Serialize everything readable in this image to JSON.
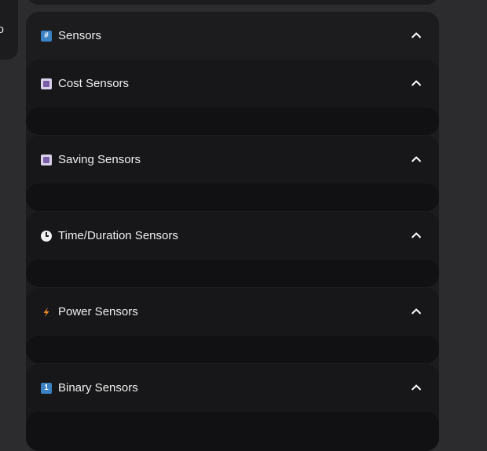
{
  "left_panel": {
    "snippet": "o"
  },
  "main": {
    "title": "Sensors",
    "icon": "hash-icon",
    "sections": [
      {
        "key": "cost",
        "title": "Cost Sensors",
        "icon": "money-icon"
      },
      {
        "key": "saving",
        "title": "Saving Sensors",
        "icon": "money-icon"
      },
      {
        "key": "time",
        "title": "Time/Duration Sensors",
        "icon": "clock-icon"
      },
      {
        "key": "power",
        "title": "Power Sensors",
        "icon": "lightning-icon"
      },
      {
        "key": "binary",
        "title": "Binary Sensors",
        "icon": "one-icon"
      }
    ]
  }
}
